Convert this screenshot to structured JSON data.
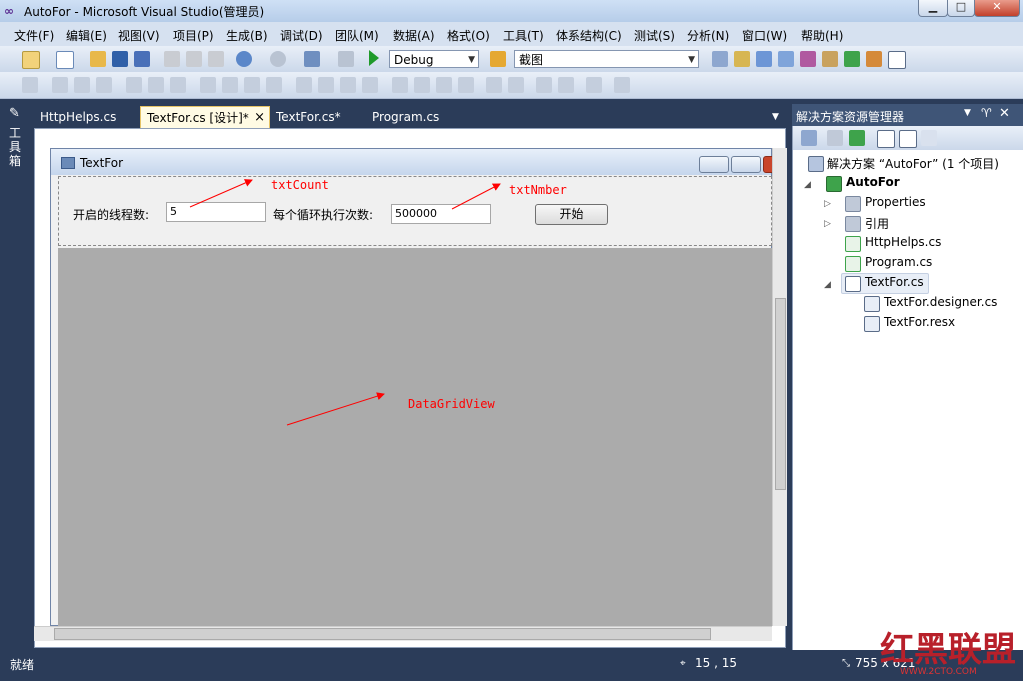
{
  "window": {
    "title": "AutoFor - Microsoft Visual Studio(管理员)",
    "min_glyph": "▁",
    "max_glyph": "□",
    "close_glyph": "✕"
  },
  "menu": [
    "文件(F)",
    "编辑(E)",
    "视图(V)",
    "项目(P)",
    "生成(B)",
    "调试(D)",
    "团队(M)",
    "数据(A)",
    "格式(O)",
    "工具(T)",
    "体系结构(C)",
    "测试(S)",
    "分析(N)",
    "窗口(W)",
    "帮助(H)"
  ],
  "toolbar": {
    "config_value": "Debug",
    "find_value": "截图"
  },
  "toolbox_label": "工具箱",
  "tabs": [
    {
      "label": "HttpHelps.cs"
    },
    {
      "label": "TextFor.cs [设计]*"
    },
    {
      "label": "TextFor.cs*"
    },
    {
      "label": "Program.cs"
    }
  ],
  "tab_close": "×",
  "tab_dropdown": "▼",
  "form": {
    "title": "TextFor",
    "thread_label": "开启的线程数:",
    "thread_value": "5",
    "loop_label": "每个循环执行次数:",
    "loop_value": "500000",
    "start_button": "开始"
  },
  "annotations": {
    "txtcount": "txtCount",
    "txtnmber": "txtNmber",
    "grid": "DataGridView"
  },
  "solution_explorer": {
    "title": "解决方案资源管理器",
    "items": [
      {
        "label": "解决方案 “AutoFor” (1 个项目)"
      },
      {
        "label": "AutoFor"
      },
      {
        "label": "Properties"
      },
      {
        "label": "引用"
      },
      {
        "label": "HttpHelps.cs"
      },
      {
        "label": "Program.cs"
      },
      {
        "label": "TextFor.cs"
      },
      {
        "label": "TextFor.designer.cs"
      },
      {
        "label": "TextFor.resx"
      }
    ]
  },
  "status": {
    "text": "就绪",
    "position": "15 , 15",
    "size": "755 x 621"
  },
  "watermark": "红黑联盟",
  "watermark_url": "WWW.2CTO.COM",
  "colors": {
    "accent": "#2b3c59",
    "annotation": "#ff0000",
    "grid_bg": "#ababab"
  }
}
